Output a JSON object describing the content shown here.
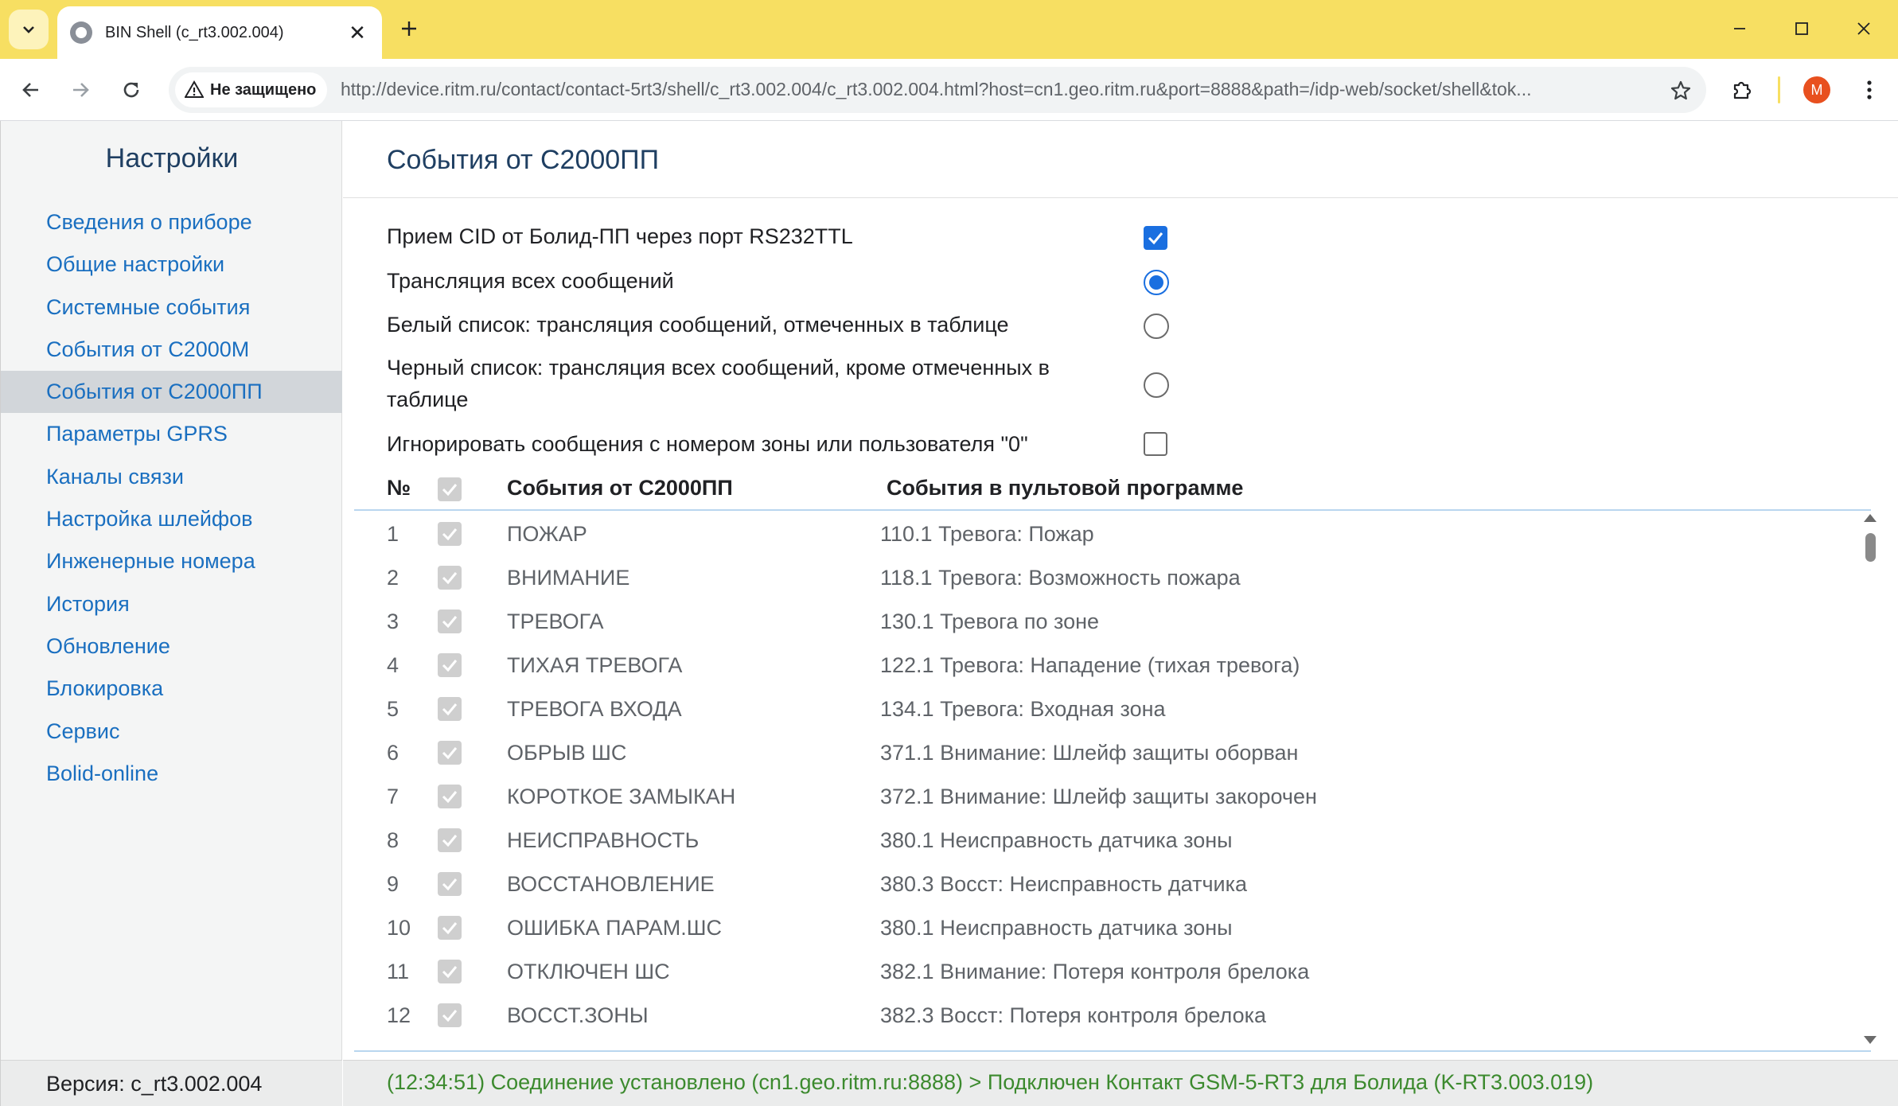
{
  "browser": {
    "tab_title": "BIN Shell (c_rt3.002.004)",
    "security_label": "Не защищено",
    "url": "http://device.ritm.ru/contact/contact-5rt3/shell/c_rt3.002.004/c_rt3.002.004.html?host=cn1.geo.ritm.ru&port=8888&path=/idp-web/socket/shell&tok...",
    "avatar_letter": "M",
    "accent_color": "#f7df62"
  },
  "sidebar": {
    "title": "Настройки",
    "items": [
      {
        "label": "Сведения о приборе"
      },
      {
        "label": "Общие настройки"
      },
      {
        "label": "Системные события"
      },
      {
        "label": "События от С2000М"
      },
      {
        "label": "События от С2000ПП",
        "active": true
      },
      {
        "label": "Параметры GPRS"
      },
      {
        "label": "Каналы связи"
      },
      {
        "label": "Настройка шлейфов"
      },
      {
        "label": "Инженерные номера"
      },
      {
        "label": "История"
      },
      {
        "label": "Обновление"
      },
      {
        "label": "Блокировка"
      },
      {
        "label": "Сервис"
      },
      {
        "label": "Bolid-online"
      }
    ],
    "version": "Версия: c_rt3.002.004"
  },
  "main": {
    "title": "События от С2000ПП",
    "options": [
      {
        "label": "Прием CID от Болид-ПП через порт RS232TTL",
        "control": "checkbox",
        "checked": true
      },
      {
        "label": "Трансляция всех сообщений",
        "control": "radio",
        "checked": true
      },
      {
        "label": "Белый список: трансляция сообщений, отмеченных в таблице",
        "control": "radio",
        "checked": false
      },
      {
        "label": "Черный список: трансляция всех сообщений, кроме отмеченных в таблице",
        "control": "radio",
        "checked": false
      },
      {
        "label": "Игнорировать сообщения с номером зоны или пользователя \"0\"",
        "control": "checkbox",
        "checked": false
      }
    ],
    "table": {
      "headers": {
        "num": "№",
        "src": "События от С2000ПП",
        "dst": "События в пультовой программе"
      },
      "rows": [
        {
          "num": "1",
          "src": "ПОЖАР",
          "dst": "110.1 Тревога: Пожар"
        },
        {
          "num": "2",
          "src": "ВНИМАНИЕ",
          "dst": "118.1 Тревога: Возможность пожара"
        },
        {
          "num": "3",
          "src": "ТРЕВОГА",
          "dst": "130.1 Тревога по зоне"
        },
        {
          "num": "4",
          "src": "ТИХАЯ ТРЕВОГА",
          "dst": "122.1 Тревога: Нападение (тихая тревога)"
        },
        {
          "num": "5",
          "src": "ТРЕВОГА ВХОДА",
          "dst": "134.1 Тревога: Входная зона"
        },
        {
          "num": "6",
          "src": "ОБРЫВ ШС",
          "dst": "371.1 Внимание: Шлейф защиты оборван"
        },
        {
          "num": "7",
          "src": "КОРОТКОЕ ЗАМЫКАН",
          "dst": "372.1 Внимание: Шлейф защиты закорочен"
        },
        {
          "num": "8",
          "src": "НЕИСПРАВНОСТЬ",
          "dst": "380.1 Неисправность датчика зоны"
        },
        {
          "num": "9",
          "src": "ВОССТАНОВЛЕНИЕ",
          "dst": "380.3 Восст: Неисправность датчика"
        },
        {
          "num": "10",
          "src": "ОШИБКА ПАРАМ.ШС",
          "dst": "380.1 Неисправность датчика зоны"
        },
        {
          "num": "11",
          "src": "ОТКЛЮЧЕН ШС",
          "dst": "382.1 Внимание: Потеря контроля брелока"
        },
        {
          "num": "12",
          "src": "ВОССТ.ЗОНЫ",
          "dst": "382.3 Восст: Потеря контроля брелока"
        }
      ]
    },
    "status": "(12:34:51) Соединение установлено (cn1.geo.ritm.ru:8888) > Подключен Контакт GSM-5-RT3 для Болида (K-RT3.003.019)"
  }
}
